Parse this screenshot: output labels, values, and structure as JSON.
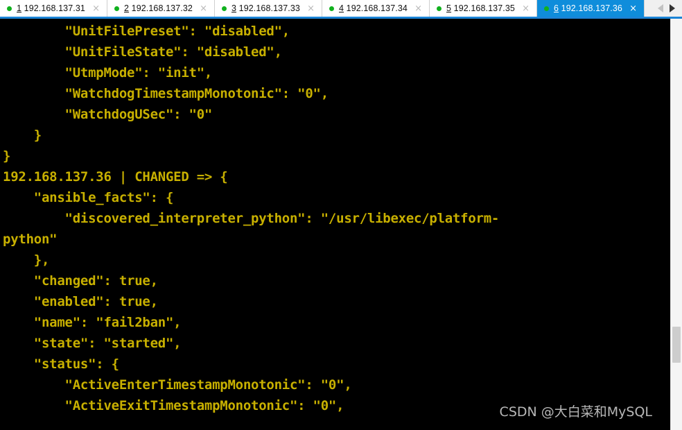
{
  "tabbar": {
    "tabs": [
      {
        "index": "1",
        "host": "192.168.137.31",
        "close": "×",
        "active": false
      },
      {
        "index": "2",
        "host": "192.168.137.32",
        "close": "×",
        "active": false
      },
      {
        "index": "3",
        "host": "192.168.137.33",
        "close": "×",
        "active": false
      },
      {
        "index": "4",
        "host": "192.168.137.34",
        "close": "×",
        "active": false
      },
      {
        "index": "5",
        "host": "192.168.137.35",
        "close": "×",
        "active": false
      },
      {
        "index": "6",
        "host": "192.168.137.36",
        "close": "×",
        "active": true
      }
    ],
    "nav_prev_label": "◀",
    "nav_next_label": "▶",
    "active_tab_color": "#0f8ddb",
    "status_dot_color": "#11b11e",
    "underline_color": "#1b84d6"
  },
  "terminal": {
    "foreground_color": "#c8b000",
    "background_color": "#000000",
    "lines": [
      "        \"UnitFilePreset\": \"disabled\",",
      "        \"UnitFileState\": \"disabled\",",
      "        \"UtmpMode\": \"init\",",
      "        \"WatchdogTimestampMonotonic\": \"0\",",
      "        \"WatchdogUSec\": \"0\"",
      "    }",
      "}",
      "192.168.137.36 | CHANGED => {",
      "    \"ansible_facts\": {",
      "        \"discovered_interpreter_python\": \"/usr/libexec/platform-",
      "python\"",
      "    },",
      "    \"changed\": true,",
      "    \"enabled\": true,",
      "    \"name\": \"fail2ban\",",
      "    \"state\": \"started\",",
      "    \"status\": {",
      "        \"ActiveEnterTimestampMonotonic\": \"0\",",
      "        \"ActiveExitTimestampMonotonic\": \"0\","
    ]
  },
  "scrollbar": {
    "track_color": "#f5f5f5",
    "thumb_color": "#cdcdcd"
  },
  "watermark": {
    "text": "CSDN @大白菜和MySQL",
    "color": "#d6d6d6"
  }
}
